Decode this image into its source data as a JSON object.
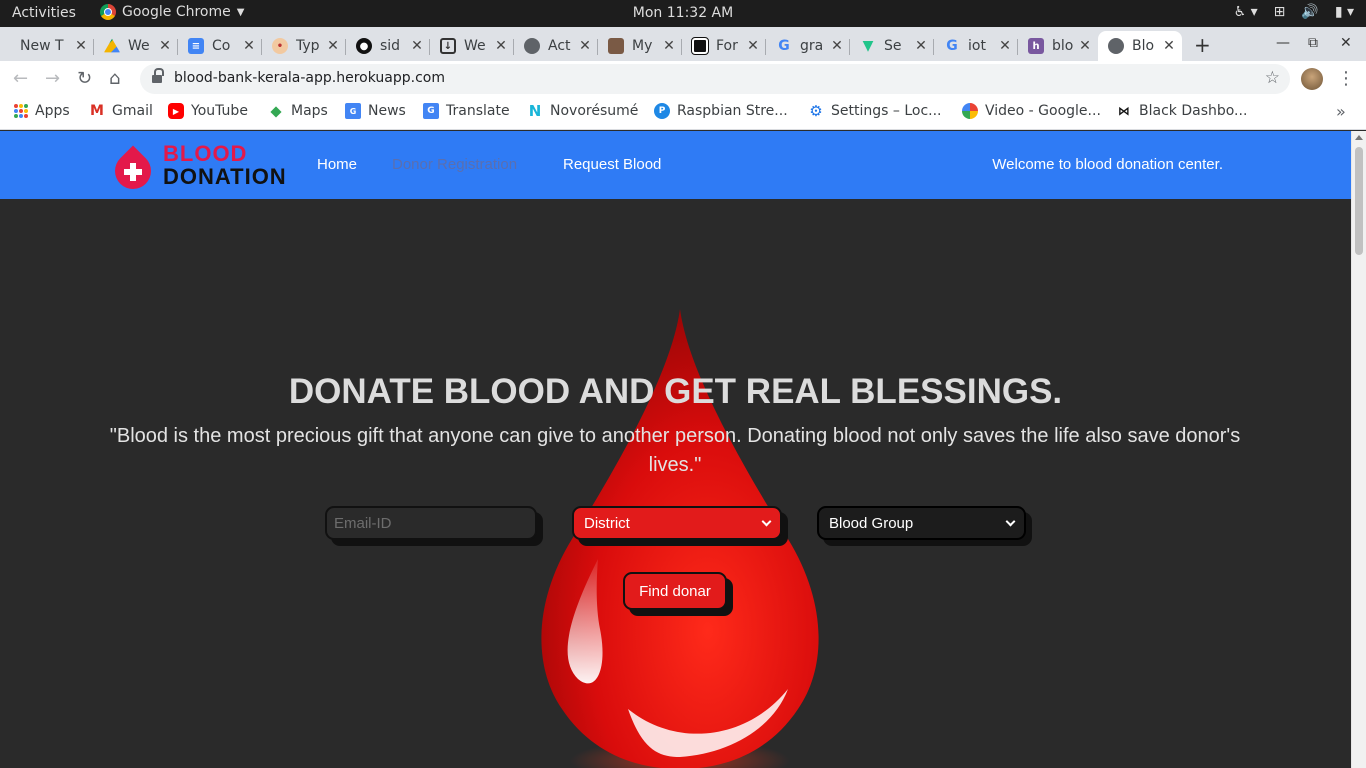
{
  "os": {
    "activities": "Activities",
    "app_name": "Google Chrome",
    "clock": "Mon 11:32 AM"
  },
  "tabs": [
    {
      "title": "New T",
      "favicon": "blank-page-icon"
    },
    {
      "title": "We",
      "favicon": "google-drive-icon"
    },
    {
      "title": "Co",
      "favicon": "google-docs-icon"
    },
    {
      "title": "Typ",
      "favicon": "avatar-character-icon"
    },
    {
      "title": "sid",
      "favicon": "github-icon"
    },
    {
      "title": "We",
      "favicon": "download-icon"
    },
    {
      "title": "Act",
      "favicon": "globe-icon"
    },
    {
      "title": "My",
      "favicon": "profile-photo-icon"
    },
    {
      "title": "For",
      "favicon": "forum-icon"
    },
    {
      "title": "gra",
      "favicon": "google-icon"
    },
    {
      "title": "Se",
      "favicon": "vue-icon"
    },
    {
      "title": "iot",
      "favicon": "google-icon"
    },
    {
      "title": "blo",
      "favicon": "heroku-icon"
    },
    {
      "title": "Blo",
      "favicon": "globe-icon",
      "active": true
    }
  ],
  "address_bar": {
    "url": "blood-bank-kerala-app.herokuapp.com"
  },
  "bookmarks": [
    {
      "label": "Apps",
      "icon": "apps-grid-icon"
    },
    {
      "label": "Gmail",
      "icon": "gmail-icon"
    },
    {
      "label": "YouTube",
      "icon": "youtube-icon"
    },
    {
      "label": "Maps",
      "icon": "maps-pin-icon"
    },
    {
      "label": "News",
      "icon": "google-news-icon"
    },
    {
      "label": "Translate",
      "icon": "google-translate-icon"
    },
    {
      "label": "Novorésumé",
      "icon": "novoresume-icon"
    },
    {
      "label": "Raspbian Stre...",
      "icon": "raspbian-icon"
    },
    {
      "label": "Settings – Loc...",
      "icon": "gear-icon"
    },
    {
      "label": "Video - Google...",
      "icon": "pinwheel-icon"
    },
    {
      "label": "Black Dashbo...",
      "icon": "bowtie-icon"
    }
  ],
  "site": {
    "logo": {
      "line1": "BLOOD",
      "line2": "DONATION"
    },
    "nav": {
      "home": "Home",
      "donor_registration": "Donor Registration",
      "request_blood": "Request Blood"
    },
    "welcome": "Welcome to blood donation center.",
    "headline": "DONATE BLOOD AND GET REAL BLESSINGS.",
    "quote": "\"Blood is the most precious gift that anyone can give to another person. Donating blood not only saves the life also save donor's lives.\"",
    "search": {
      "email_placeholder": "Email-ID",
      "district_selected": "District",
      "blood_group_selected": "Blood Group",
      "button": "Find donar"
    }
  },
  "colors": {
    "nav_blue": "#2f7bf5",
    "brand_red": "#e3194a",
    "action_red": "#e21b1b",
    "page_bg": "#2a2a2a"
  }
}
